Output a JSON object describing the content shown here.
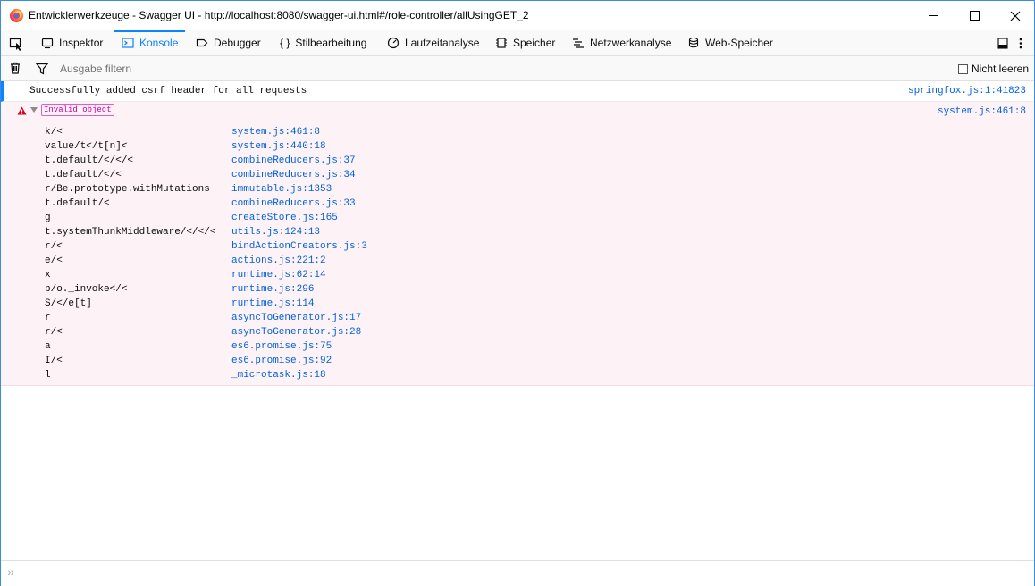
{
  "window": {
    "title": "Entwicklerwerkzeuge - Swagger UI - http://localhost:8080/swagger-ui.html#/role-controller/allUsingGET_2"
  },
  "tabs": [
    {
      "label": "Inspektor",
      "icon": "inspector-icon"
    },
    {
      "label": "Konsole",
      "icon": "console-icon",
      "selected": true
    },
    {
      "label": "Debugger",
      "icon": "debugger-icon"
    },
    {
      "label": "Stilbearbeitung",
      "icon": "style-editor-icon"
    },
    {
      "label": "Laufzeitanalyse",
      "icon": "performance-icon"
    },
    {
      "label": "Speicher",
      "icon": "memory-icon"
    },
    {
      "label": "Netzwerkanalyse",
      "icon": "network-icon"
    },
    {
      "label": "Web-Speicher",
      "icon": "storage-icon"
    }
  ],
  "filter": {
    "placeholder": "Ausgabe filtern",
    "persist_label": "Nicht leeren"
  },
  "console": {
    "info": {
      "text": "Successfully added csrf header for all requests",
      "source": "springfox.js:1:41823"
    },
    "error": {
      "tag": "Invalid object",
      "source": "system.js:461:8",
      "frames": [
        {
          "fn": "k/<",
          "loc": "system.js:461:8"
        },
        {
          "fn": "value/t</t[n]<",
          "loc": "system.js:440:18"
        },
        {
          "fn": "t.default/</</<",
          "loc": "combineReducers.js:37"
        },
        {
          "fn": "t.default/</<",
          "loc": "combineReducers.js:34"
        },
        {
          "fn": "r/Be.prototype.withMutations",
          "loc": "immutable.js:1353"
        },
        {
          "fn": "t.default/<",
          "loc": "combineReducers.js:33"
        },
        {
          "fn": "g",
          "loc": "createStore.js:165"
        },
        {
          "fn": "t.systemThunkMiddleware/</</<",
          "loc": "utils.js:124:13"
        },
        {
          "fn": "r/<",
          "loc": "bindActionCreators.js:3"
        },
        {
          "fn": "e/<",
          "loc": "actions.js:221:2"
        },
        {
          "fn": "x",
          "loc": "runtime.js:62:14"
        },
        {
          "fn": "b/o._invoke</<",
          "loc": "runtime.js:296"
        },
        {
          "fn": "S/</e[t]",
          "loc": "runtime.js:114"
        },
        {
          "fn": "r",
          "loc": "asyncToGenerator.js:17"
        },
        {
          "fn": "r/<",
          "loc": "asyncToGenerator.js:28"
        },
        {
          "fn": "a",
          "loc": "es6.promise.js:75"
        },
        {
          "fn": "I/<",
          "loc": "es6.promise.js:92"
        },
        {
          "fn": "l",
          "loc": "_microtask.js:18"
        }
      ]
    },
    "prompt": "»"
  },
  "colors": {
    "accent": "#0a84ff",
    "link": "#0060df",
    "error_bg": "#fdf2f5",
    "error_tag": "#c600b0"
  }
}
